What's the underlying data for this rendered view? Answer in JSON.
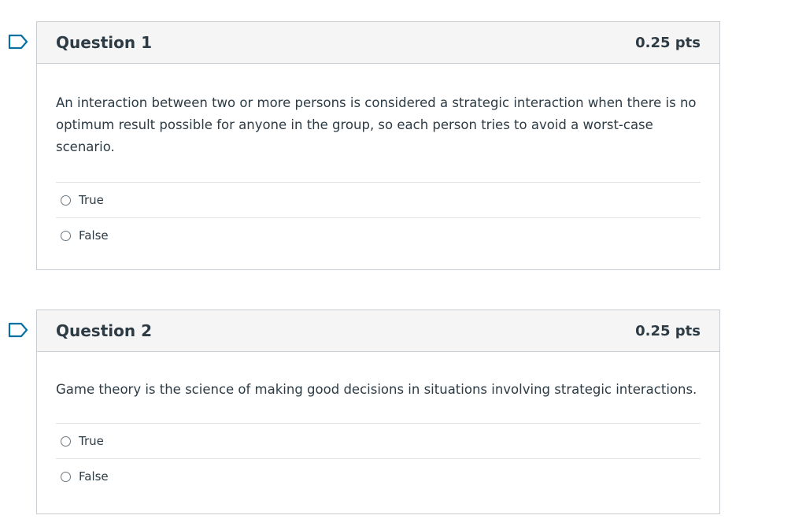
{
  "questions": [
    {
      "title": "Question 1",
      "points": "0.25 pts",
      "text": "An interaction between two or more persons is considered a strategic interaction when there is no optimum result possible for anyone in the group, so each person tries to avoid a worst-case scenario.",
      "options": [
        "True",
        "False"
      ]
    },
    {
      "title": "Question 2",
      "points": "0.25 pts",
      "text": "Game theory is the science of making good decisions in situations involving strategic interactions.",
      "options": [
        "True",
        "False"
      ]
    }
  ],
  "colors": {
    "flag": "#0770a3",
    "header_bg": "#f5f5f5",
    "border": "#c7cdd1",
    "text": "#2d3b45"
  }
}
